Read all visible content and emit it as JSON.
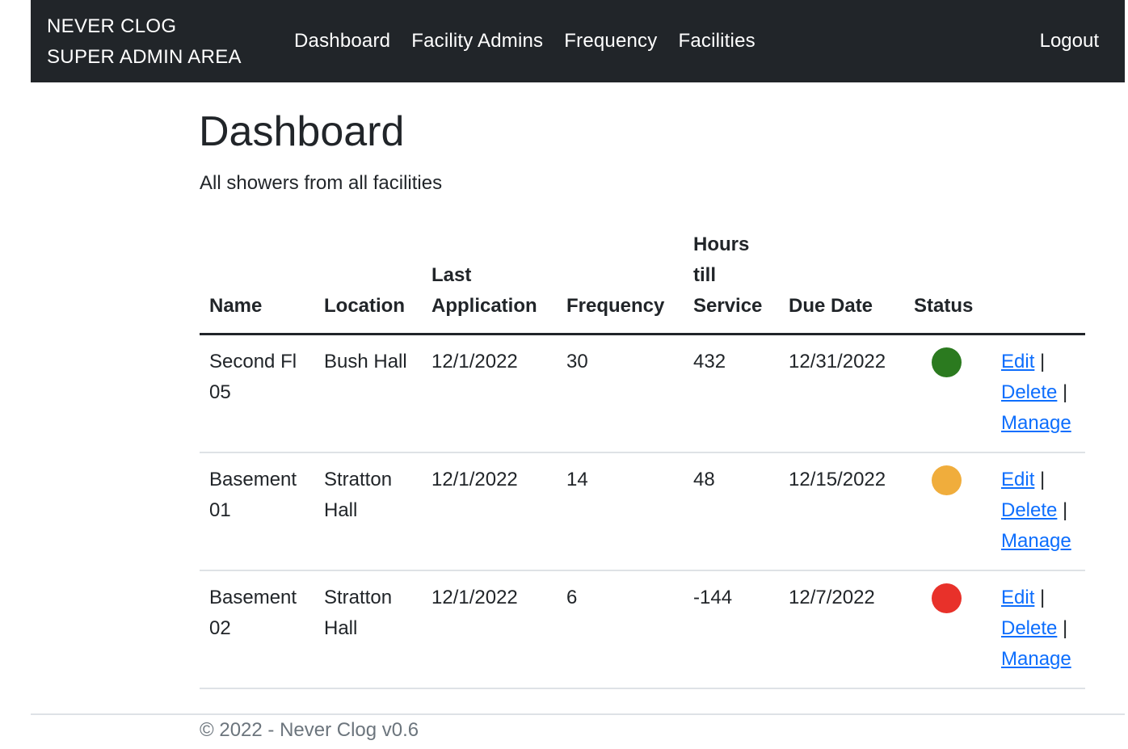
{
  "navbar": {
    "brand_line1": "NEVER CLOG",
    "brand_line2": "SUPER ADMIN AREA",
    "links": [
      "Dashboard",
      "Facility Admins",
      "Frequency",
      "Facilities"
    ],
    "logout": "Logout"
  },
  "page": {
    "title": "Dashboard",
    "subtitle": "All showers from all facilities"
  },
  "table": {
    "headers": {
      "name": "Name",
      "location": "Location",
      "last_application": "Last Application",
      "frequency": "Frequency",
      "hours_till_service": "Hours till Service",
      "due_date": "Due Date",
      "status": "Status",
      "actions": ""
    },
    "rows": [
      {
        "name": "Second Fl 05",
        "location": "Bush Hall",
        "last_application": "12/1/2022",
        "frequency": "30",
        "hours_till_service": "432",
        "due_date": "12/31/2022",
        "status_color": "#2b7a1f"
      },
      {
        "name": "Basement 01",
        "location": "Stratton Hall",
        "last_application": "12/1/2022",
        "frequency": "14",
        "hours_till_service": "48",
        "due_date": "12/15/2022",
        "status_color": "#f0ad3c"
      },
      {
        "name": "Basement 02",
        "location": "Stratton Hall",
        "last_application": "12/1/2022",
        "frequency": "6",
        "hours_till_service": "-144",
        "due_date": "12/7/2022",
        "status_color": "#e8312a"
      }
    ],
    "action_labels": {
      "edit": "Edit",
      "delete": "Delete",
      "manage": "Manage",
      "separator": "|"
    }
  },
  "footer": {
    "text": "© 2022 - Never Clog v0.6"
  }
}
